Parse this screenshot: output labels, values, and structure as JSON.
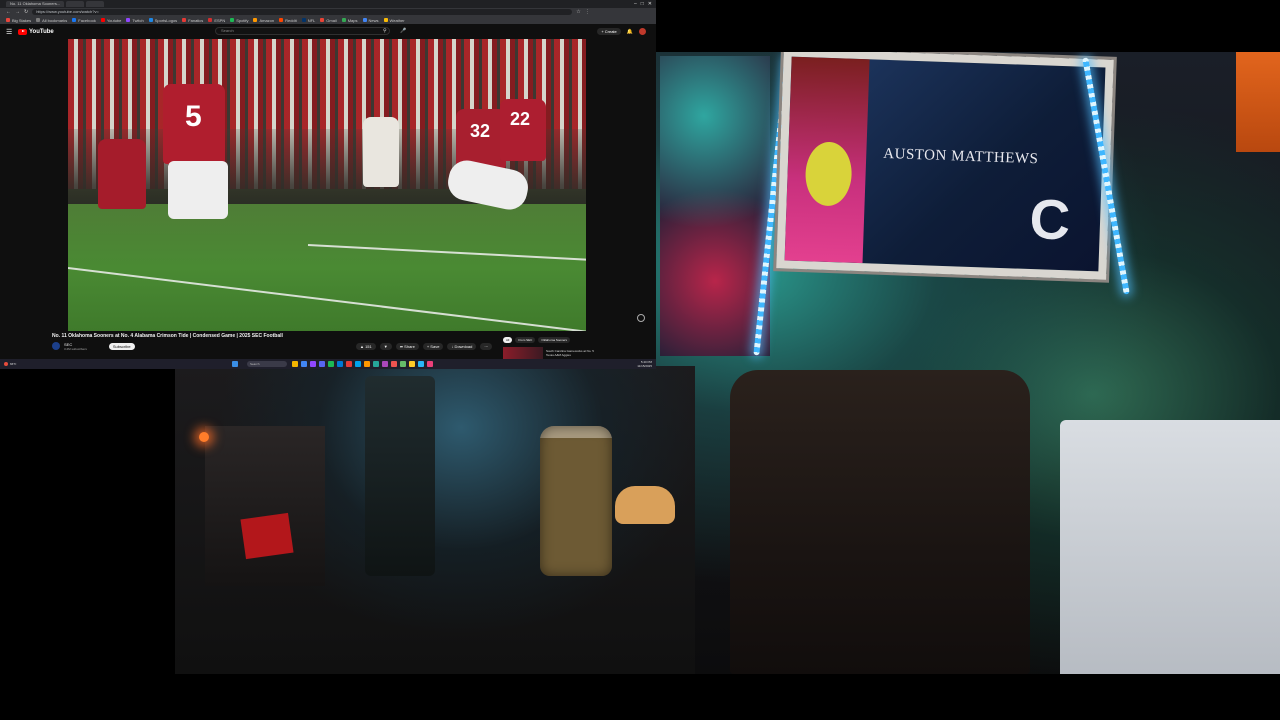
{
  "browser": {
    "tabs": [
      "No. 11 Oklahoma Sooners...",
      "",
      "",
      "",
      "",
      ""
    ],
    "url": "https://www.youtube.com/watch?v=",
    "bookmarks": [
      {
        "label": "Big Stakes",
        "color": "#e8453c"
      },
      {
        "label": "All bookmarks",
        "color": "#7b7b7b"
      },
      {
        "label": "Facebook",
        "color": "#1877f2"
      },
      {
        "label": "Youtube",
        "color": "#ff0000"
      },
      {
        "label": "Twitch",
        "color": "#9146ff"
      },
      {
        "label": "SportsLogos",
        "color": "#1e88e5"
      },
      {
        "label": "Fanatics",
        "color": "#e53935"
      },
      {
        "label": "ESPN",
        "color": "#d32f2f"
      },
      {
        "label": "Spotify",
        "color": "#1db954"
      },
      {
        "label": "Amazon",
        "color": "#ff9900"
      },
      {
        "label": "Reddit",
        "color": "#ff4500"
      },
      {
        "label": "NFL",
        "color": "#013369"
      },
      {
        "label": "Gmail",
        "color": "#ea4335"
      },
      {
        "label": "Maps",
        "color": "#34a853"
      },
      {
        "label": "News",
        "color": "#4285f4"
      },
      {
        "label": "Weather",
        "color": "#fbbc05"
      }
    ]
  },
  "youtube": {
    "logo_text": "YouTube",
    "search_placeholder": "Search",
    "create_label": "+ Create",
    "video_title": "No. 11 Oklahoma Sooners at No. 4 Alabama Crimson Tide | Condensed Game | 2025 SEC Football",
    "channel_name": "SEC",
    "channel_subs": "3.2M subscribers",
    "subscribe_label": "Subscribe",
    "actions": [
      "▲ 151",
      "▼",
      "➦ Share",
      "+ Save",
      "↓ Download",
      "⋯"
    ],
    "filters": [
      "All",
      "From SEC",
      "Oklahoma Sooners"
    ],
    "rec_title": "South Carolina Gamecocks at No. 5 Texas A&M Aggies",
    "jersey_numbers": [
      "5",
      "32",
      "22"
    ]
  },
  "poster": {
    "name": "AUSTON MATTHEWS",
    "letter": "C"
  },
  "taskbar": {
    "weather": "66°F",
    "search_placeholder": "Search",
    "clock_time": "5:40 PM",
    "clock_date": "11/15/2025"
  },
  "colors": {
    "youtube_red": "#ff0000",
    "crimson": "#9e1b32",
    "led_blue": "#3fb7ff"
  }
}
